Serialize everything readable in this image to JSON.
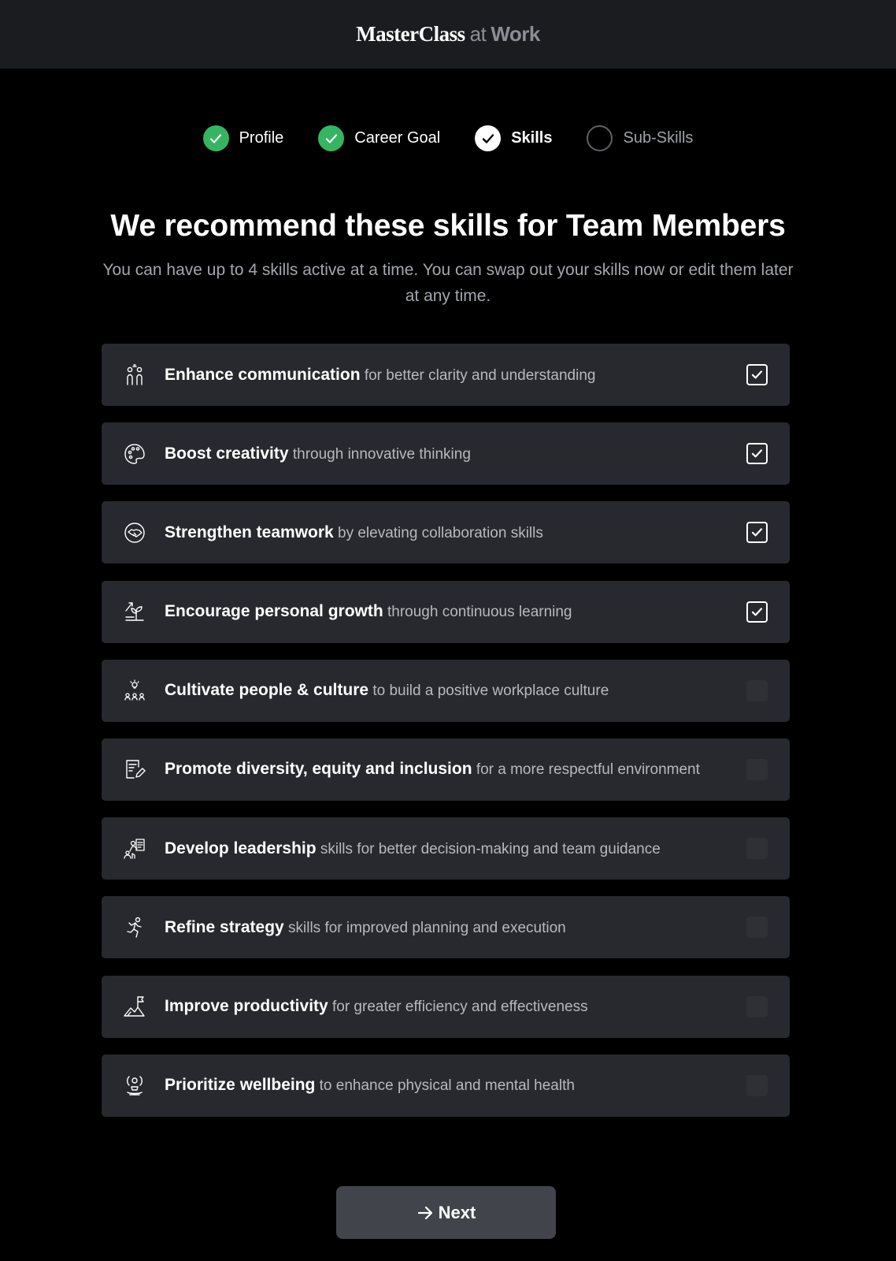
{
  "header": {
    "brand": "MasterClass",
    "at": "at",
    "work": "Work"
  },
  "stepper": {
    "steps": [
      {
        "label": "Profile",
        "state": "done"
      },
      {
        "label": "Career Goal",
        "state": "done"
      },
      {
        "label": "Skills",
        "state": "current"
      },
      {
        "label": "Sub-Skills",
        "state": "todo"
      }
    ]
  },
  "main": {
    "title": "We recommend these skills for Team Members",
    "subtitle": "You can have up to 4 skills active at a time. You can swap out your skills now or edit them later at any time."
  },
  "skills": [
    {
      "title": "Enhance communication",
      "desc": "for better clarity and understanding",
      "checked": true,
      "icon": "communication-icon"
    },
    {
      "title": "Boost creativity",
      "desc": "through innovative thinking",
      "checked": true,
      "icon": "palette-icon"
    },
    {
      "title": "Strengthen teamwork",
      "desc": "by elevating collaboration skills",
      "checked": true,
      "icon": "handshake-icon"
    },
    {
      "title": "Encourage personal growth",
      "desc": "through continuous learning",
      "checked": true,
      "icon": "plant-growth-icon"
    },
    {
      "title": "Cultivate people & culture",
      "desc": "to build a positive workplace culture",
      "checked": false,
      "icon": "people-idea-icon"
    },
    {
      "title": "Promote diversity, equity and inclusion",
      "desc": "for a more respectful environment",
      "checked": false,
      "icon": "document-pen-icon"
    },
    {
      "title": "Develop leadership",
      "desc": "skills for better decision-making and team guidance",
      "checked": false,
      "icon": "leader-presentation-icon"
    },
    {
      "title": "Refine strategy",
      "desc": "skills for improved planning and execution",
      "checked": false,
      "icon": "running-person-icon"
    },
    {
      "title": "Improve productivity",
      "desc": "for greater efficiency and effectiveness",
      "checked": false,
      "icon": "mountain-flag-icon"
    },
    {
      "title": "Prioritize wellbeing",
      "desc": "to enhance physical and mental health",
      "checked": false,
      "icon": "meditation-icon"
    }
  ],
  "footer": {
    "next_label": "Next"
  },
  "colors": {
    "background": "#000000",
    "topbar": "#1a1c20",
    "row": "#27292e",
    "done": "#35b561",
    "button": "#41444b"
  }
}
